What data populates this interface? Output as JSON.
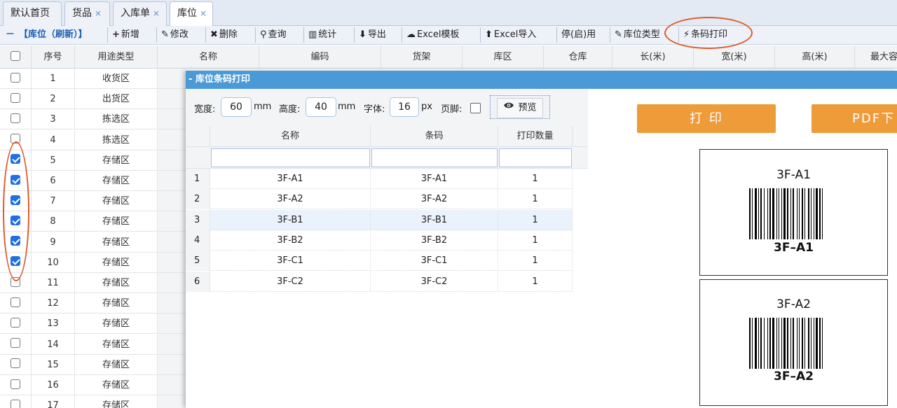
{
  "tabs": [
    {
      "label": "默认首页",
      "closable": false
    },
    {
      "label": "货品",
      "closable": true
    },
    {
      "label": "入库单",
      "closable": true
    },
    {
      "label": "库位",
      "closable": true,
      "active": true
    }
  ],
  "close_glyph": "×",
  "toolbar": {
    "title": "【库位（刷新）】",
    "collapse": "－",
    "buttons": [
      {
        "icon": "plus-icon",
        "glyph": "+",
        "label": "新增"
      },
      {
        "icon": "pencil-icon",
        "glyph": "✎",
        "label": "修改"
      },
      {
        "icon": "close-icon",
        "glyph": "✖",
        "label": "删除"
      },
      {
        "icon": "search-icon",
        "glyph": "⚲",
        "label": "查询"
      },
      {
        "icon": "bar-chart-icon",
        "glyph": "▥",
        "label": "统计"
      },
      {
        "icon": "arrow-down-icon",
        "glyph": "⬇",
        "label": "导出"
      },
      {
        "icon": "cloud-download-icon",
        "glyph": "☁",
        "label": "Excel模板"
      },
      {
        "icon": "arrow-up-icon",
        "glyph": "⬆",
        "label": "Excel导入"
      },
      {
        "icon": "",
        "glyph": "",
        "label": "停(启)用"
      },
      {
        "icon": "pencil-icon",
        "glyph": "✎",
        "label": "库位类型"
      },
      {
        "icon": "bolt-icon",
        "glyph": "⚡",
        "label": "条码打印"
      }
    ]
  },
  "grid": {
    "headers": [
      "序号",
      "用途类型",
      "名称",
      "编码",
      "货架",
      "库区",
      "仓库",
      "长(米)",
      "宽(米)",
      "高(米)",
      "最大容"
    ],
    "rows": [
      {
        "no": "1",
        "type": "收货区",
        "checked": false
      },
      {
        "no": "2",
        "type": "出货区",
        "checked": false
      },
      {
        "no": "3",
        "type": "拣选区",
        "checked": false
      },
      {
        "no": "4",
        "type": "拣选区",
        "checked": false
      },
      {
        "no": "5",
        "type": "存储区",
        "checked": true
      },
      {
        "no": "6",
        "type": "存储区",
        "checked": true
      },
      {
        "no": "7",
        "type": "存储区",
        "checked": true
      },
      {
        "no": "8",
        "type": "存储区",
        "checked": true
      },
      {
        "no": "9",
        "type": "存储区",
        "checked": true
      },
      {
        "no": "10",
        "type": "存储区",
        "checked": true
      },
      {
        "no": "11",
        "type": "存储区",
        "checked": false
      },
      {
        "no": "12",
        "type": "存储区",
        "checked": false
      },
      {
        "no": "13",
        "type": "存储区",
        "checked": false
      },
      {
        "no": "14",
        "type": "存储区",
        "checked": false
      },
      {
        "no": "15",
        "type": "存储区",
        "checked": false
      },
      {
        "no": "16",
        "type": "存储区",
        "checked": false
      },
      {
        "no": "17",
        "type": "存储区",
        "checked": false
      }
    ]
  },
  "dialog": {
    "title": "- 库位条码打印",
    "form": {
      "width_label": "宽度:",
      "width_value": "60",
      "width_unit": "mm",
      "height_label": "高度:",
      "height_value": "40",
      "height_unit": "mm",
      "font_label": "字体:",
      "font_value": "16",
      "font_unit": "px",
      "footer_label": "页脚:",
      "preview_icon": "eye-icon",
      "preview_label": "预览"
    },
    "table": {
      "headers": [
        "名称",
        "条码",
        "打印数量"
      ],
      "rows": [
        {
          "idx": "1",
          "name": "3F-A1",
          "code": "3F-A1",
          "qty": "1"
        },
        {
          "idx": "2",
          "name": "3F-A2",
          "code": "3F-A2",
          "qty": "1"
        },
        {
          "idx": "3",
          "name": "3F-B1",
          "code": "3F-B1",
          "qty": "1"
        },
        {
          "idx": "4",
          "name": "3F-B2",
          "code": "3F-B2",
          "qty": "1"
        },
        {
          "idx": "5",
          "name": "3F-C1",
          "code": "3F-C1",
          "qty": "1"
        },
        {
          "idx": "6",
          "name": "3F-C2",
          "code": "3F-C2",
          "qty": "1"
        }
      ]
    },
    "print_button": "打 印",
    "pdf_button": "PDF下",
    "labels": [
      {
        "top": "3F-A1",
        "bottom": "3F–A1"
      },
      {
        "top": "3F-A2",
        "bottom": "3F–A2"
      }
    ]
  },
  "colors": {
    "accent": "#4b9ad8",
    "orange": "#ee9b3a",
    "highlight": "#e05a2b",
    "check": "#1f6fe5"
  }
}
